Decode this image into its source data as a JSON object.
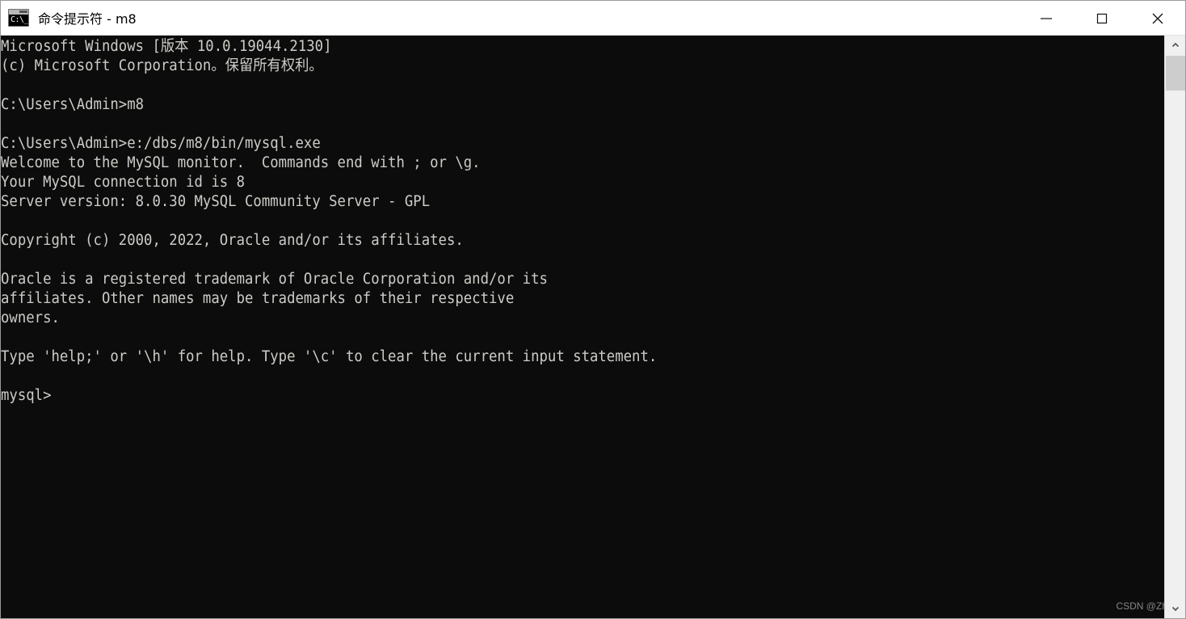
{
  "window": {
    "title": "命令提示符 - m8",
    "icon": "cmd-icon",
    "icon_glyph": "C:\\_",
    "background_color": "#0c0c0c",
    "text_color": "#ccccc7",
    "titlebar_color": "#ffffff"
  },
  "window_controls": {
    "minimize_label": "最小化",
    "maximize_label": "最大化",
    "close_label": "关闭"
  },
  "terminal": {
    "prompt": "mysql>",
    "content": "Microsoft Windows [版本 10.0.19044.2130]\n(c) Microsoft Corporation。保留所有权利。\n\nC:\\Users\\Admin>m8\n\nC:\\Users\\Admin>e:/dbs/m8/bin/mysql.exe\nWelcome to the MySQL monitor.  Commands end with ; or \\g.\nYour MySQL connection id is 8\nServer version: 8.0.30 MySQL Community Server - GPL\n\nCopyright (c) 2000, 2022, Oracle and/or its affiliates.\n\nOracle is a registered trademark of Oracle Corporation and/or its\naffiliates. Other names may be trademarks of their respective\nowners.\n\nType 'help;' or '\\h' for help. Type '\\c' to clear the current input statement.\n\nmysql>",
    "lines": [
      "Microsoft Windows [版本 10.0.19044.2130]",
      "(c) Microsoft Corporation。保留所有权利。",
      "",
      "C:\\Users\\Admin>m8",
      "",
      "C:\\Users\\Admin>e:/dbs/m8/bin/mysql.exe",
      "Welcome to the MySQL monitor.  Commands end with ; or \\g.",
      "Your MySQL connection id is 8",
      "Server version: 8.0.30 MySQL Community Server - GPL",
      "",
      "Copyright (c) 2000, 2022, Oracle and/or its affiliates.",
      "",
      "Oracle is a registered trademark of Oracle Corporation and/or its",
      "affiliates. Other names may be trademarks of their respective",
      "owners.",
      "",
      "Type 'help;' or '\\h' for help. Type '\\c' to clear the current input statement.",
      "",
      "mysql>"
    ]
  },
  "scrollbar": {
    "up_arrow": "chevron-up-icon",
    "down_arrow": "chevron-down-icon",
    "track_color": "#f0f0f0",
    "thumb_color": "#cdcdcd"
  },
  "watermark": {
    "text": "CSDN @Zh-jie"
  }
}
